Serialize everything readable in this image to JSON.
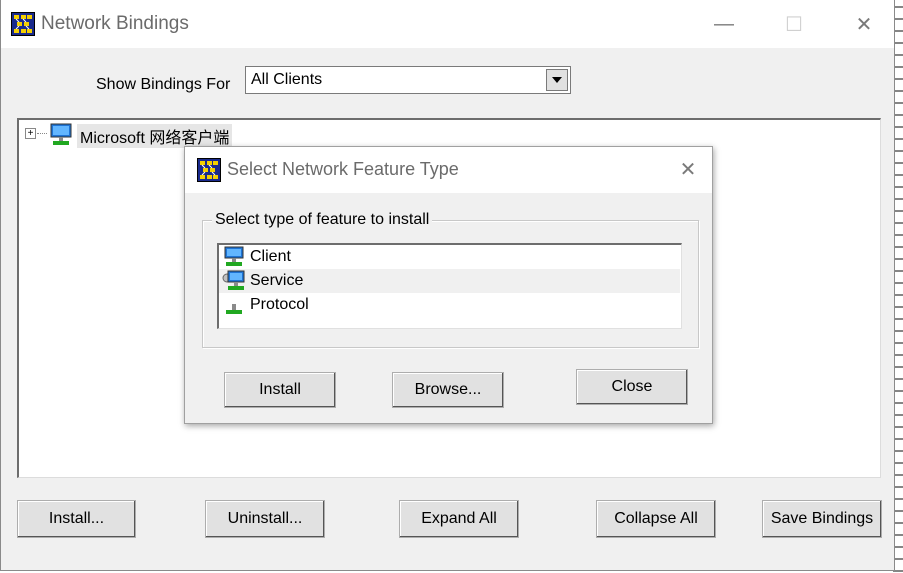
{
  "window": {
    "title": "Network Bindings",
    "controls": {
      "minimize": "—",
      "maximize": "☐",
      "close": "✕"
    }
  },
  "filter": {
    "label": "Show Bindings For",
    "selected": "All Clients"
  },
  "tree": {
    "items": [
      {
        "label": "Microsoft 网络客户端",
        "expander": "+",
        "icon": "network-client-icon"
      }
    ]
  },
  "buttons": {
    "install": "Install...",
    "uninstall": "Uninstall...",
    "expand_all": "Expand All",
    "collapse_all": "Collapse All",
    "save_bindings": "Save Bindings"
  },
  "dialog": {
    "title": "Select Network Feature Type",
    "close": "✕",
    "group_label": "Select type of feature to install",
    "items": [
      {
        "label": "Client",
        "icon": "client-icon"
      },
      {
        "label": "Service",
        "icon": "service-icon",
        "selected": true
      },
      {
        "label": "Protocol",
        "icon": "protocol-icon"
      }
    ],
    "buttons": {
      "install": "Install",
      "browse": "Browse...",
      "close": "Close"
    }
  },
  "colors": {
    "title_text": "#6b6b6b",
    "app_icon_bg": "#1a2a8c",
    "app_icon_fg": "#f5d000",
    "window_bg": "#f0f0f0"
  }
}
